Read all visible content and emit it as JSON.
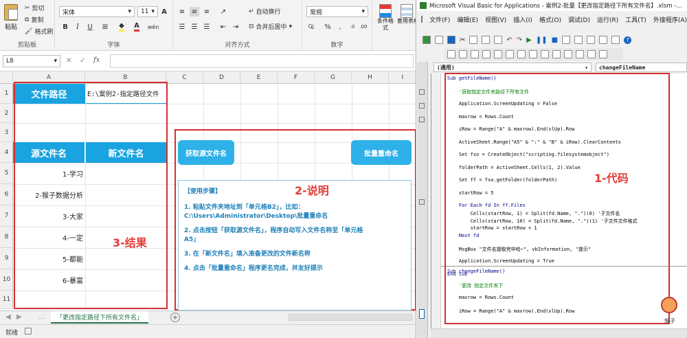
{
  "excel": {
    "clipboard": {
      "paste": "粘贴",
      "cut": "剪切",
      "copy": "复制",
      "format_painter": "格式刷",
      "group": "剪贴板"
    },
    "font": {
      "name": "宋体",
      "size": "11",
      "bold": "B",
      "italic": "I",
      "underline": "U",
      "group": "字体",
      "grow": "A",
      "shrink": "A",
      "wen": "wén"
    },
    "alignment": {
      "wrap": "自动换行",
      "merge": "合并后居中",
      "group": "对齐方式"
    },
    "number": {
      "format": "常规",
      "percent": "%",
      "comma": ",",
      "group": "数字"
    },
    "styles": {
      "conditional": "条件格式",
      "table": "套用表格"
    },
    "name_box": "L8",
    "fx": "fx",
    "columns": [
      "A",
      "B",
      "C",
      "D",
      "E",
      "F",
      "G",
      "H",
      "I"
    ],
    "rows": [
      "1",
      "2",
      "3",
      "4",
      "5",
      "6",
      "7",
      "8",
      "9",
      "10",
      "11"
    ],
    "cells": {
      "a1": "文件路径",
      "b1": "E:\\案例2-指定路径文件",
      "a4": "源文件名",
      "b4": "新文件名",
      "list": [
        "1-学习",
        "2-猴子数据分析",
        "3-大家",
        "4-一定",
        "5-都能",
        "6-暴富"
      ]
    },
    "buttons": {
      "get_names": "获取源文件名",
      "rename": "批量重命名"
    },
    "instructions": {
      "title": "【使用步骤】",
      "steps": [
        "1. 粘贴文件夹地址到「单元格B2」，比如：",
        "C:\\Users\\Administrator\\Desktop\\批量重命名",
        "2. 点击按钮「获取源文件名」，程序自动写入文件名称至「单元格",
        "A5」",
        "3. 在「新文件名」填入准备更改的文件新名称",
        "4. 点击「批量重命名」程序更名完成，并友好提示"
      ]
    },
    "annotations": {
      "result": "3-结果",
      "explain": "2-说明",
      "code": "1-代码"
    },
    "sheet_tab": "「更改指定路径下所有文件名」",
    "status": "就绪",
    "tab_nav": [
      "◀",
      "▶",
      "..."
    ],
    "add_sheet": "+"
  },
  "vba": {
    "title": "Microsoft Visual Basic for Applications - 案例2-批量【更改指定路径下所有文件名】.xlsm -...",
    "menu": [
      "文件(F)",
      "编辑(E)",
      "视图(V)",
      "插入(I)",
      "格式(O)",
      "调试(D)",
      "运行(R)",
      "工具(T)",
      "外接程序(A)"
    ],
    "object_combo": "(通用)",
    "proc_combo": "changeFileName",
    "code_lines": [
      {
        "t": "Sub getFileName()",
        "c": "kw"
      },
      {
        "t": "    '获取指定文件夹路径下所有文件",
        "c": "cm"
      },
      {
        "t": "    Application.ScreenUpdating = False",
        "c": ""
      },
      {
        "t": "    maxrow = Rows.Count",
        "c": ""
      },
      {
        "t": "    iRow = Range(\"A\" & maxrow).End(xlUp).Row",
        "c": ""
      },
      {
        "t": "    ActiveSheet.Range(\"A5\" & \":\" & \"B\" & iRow).ClearContents",
        "c": ""
      },
      {
        "t": "    Set fso = CreateObject(\"scripting.filesystemobject\")",
        "c": ""
      },
      {
        "t": "    folderPath = ActiveSheet.Cells(1, 2).Value",
        "c": ""
      },
      {
        "t": "    Set ff = fso.getFolder(folderPath)",
        "c": ""
      },
      {
        "t": "    startRow = 5",
        "c": ""
      },
      {
        "t": "    For Each fd In ff.Files",
        "c": "kw"
      },
      {
        "t": "        Cells(startRow, 1) = Split(fd.Name, \".\")(0) '子文件名",
        "c": ""
      },
      {
        "t": "        Cells(startRow, 10) = Split(fd.Name, \".\")(1) '子文件文件格式",
        "c": ""
      },
      {
        "t": "        startRow = startRow + 1",
        "c": ""
      },
      {
        "t": "    Next fd",
        "c": "kw"
      },
      {
        "t": "    MsgBox \"文件名提取完毕哈~\", vbInformation, \"提示\"",
        "c": ""
      },
      {
        "t": "    Application.ScreenUpdating = True",
        "c": ""
      },
      {
        "t": "End Sub",
        "c": "kw"
      },
      {
        "t": "Sub changeFileName()",
        "c": "kw"
      },
      {
        "t": "    '更改 指定文件夹下",
        "c": "cm"
      },
      {
        "t": "    maxrow = Rows.Count",
        "c": ""
      },
      {
        "t": "    iRow = Range(\"A\" & maxrow).End(xlUp).Row",
        "c": ""
      }
    ],
    "watermark": "猴子"
  }
}
